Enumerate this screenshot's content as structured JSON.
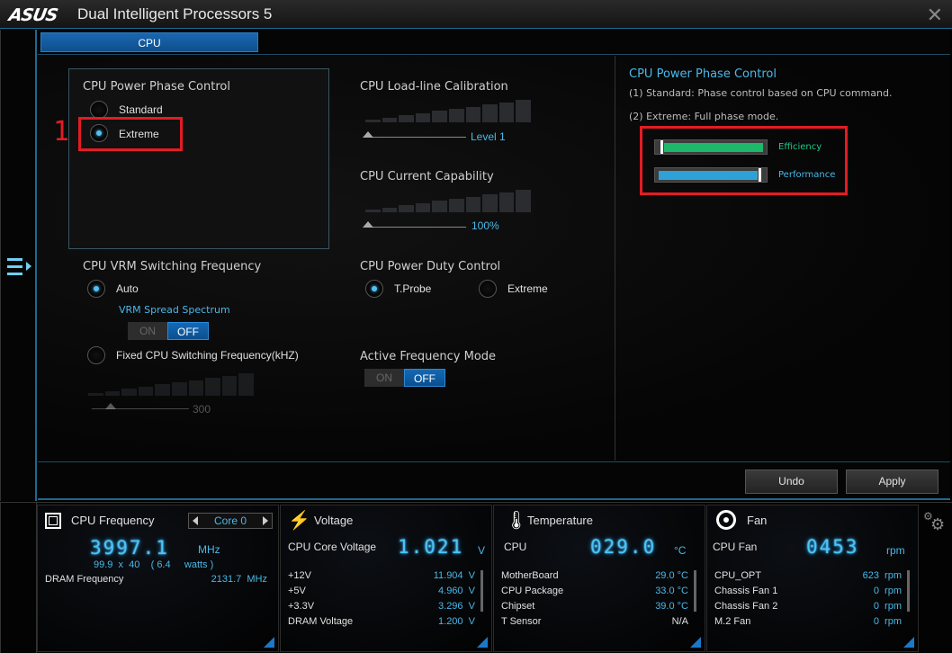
{
  "window": {
    "logo": "/ISUS",
    "title": "Dual Intelligent Processors 5",
    "close_icon": "close-icon"
  },
  "tabs": [
    {
      "label": "CPU",
      "active": true
    }
  ],
  "phase_control": {
    "title": "CPU Power Phase Control",
    "options": [
      {
        "label": "Standard",
        "selected": false
      },
      {
        "label": "Extreme",
        "selected": true
      }
    ],
    "annotation": "1"
  },
  "vrm": {
    "title": "CPU VRM Switching Frequency",
    "auto_label": "Auto",
    "auto_selected": true,
    "spread_title": "VRM Spread Spectrum",
    "spread_toggle": {
      "on": "ON",
      "off": "OFF",
      "value": "OFF"
    },
    "fixed_label": "Fixed CPU Switching Frequency(kHZ)",
    "fixed_selected": false,
    "fixed_value": "300"
  },
  "llc": {
    "title": "CPU Load-line Calibration",
    "value": "Level 1"
  },
  "current": {
    "title": "CPU Current Capability",
    "value": "100%"
  },
  "duty": {
    "title": "CPU Power Duty Control",
    "options": [
      {
        "label": "T.Probe",
        "selected": true
      },
      {
        "label": "Extreme",
        "selected": false
      }
    ]
  },
  "afm": {
    "title": "Active Frequency Mode",
    "toggle": {
      "on": "ON",
      "off": "OFF",
      "value": "OFF"
    }
  },
  "info": {
    "title": "CPU Power Phase Control",
    "lines": [
      "(1) Standard: Phase control based on CPU command.",
      "(2) Extreme: Full phase mode."
    ],
    "meters": [
      {
        "label": "Efficiency",
        "color": "#1db86a",
        "label_color": "#1dc98a",
        "level": 0.05
      },
      {
        "label": "Performance",
        "color": "#2ea2d6",
        "label_color": "#4ab8e8",
        "level": 0.95
      }
    ]
  },
  "actions": {
    "undo": "Undo",
    "apply": "Apply"
  },
  "dock": {
    "cpu_freq": {
      "title": "CPU Frequency",
      "core": "Core 0",
      "value": "3997.1",
      "unit": "MHz",
      "detail": "99.9  x  40    ( 6.4     watts )",
      "dram_label": "DRAM Frequency",
      "dram_value": "2131.7  MHz"
    },
    "voltage": {
      "title": "Voltage",
      "main_label": "CPU Core Voltage",
      "value": "1.021",
      "unit": "V",
      "rows": [
        {
          "label": "+12V",
          "value": "11.904  V"
        },
        {
          "label": "+5V",
          "value": "4.960  V"
        },
        {
          "label": "+3.3V",
          "value": "3.296  V"
        },
        {
          "label": "DRAM Voltage",
          "value": "1.200  V"
        }
      ]
    },
    "temperature": {
      "title": "Temperature",
      "main_label": "CPU",
      "value": "029.0",
      "unit": "°C",
      "rows": [
        {
          "label": "MotherBoard",
          "value": "29.0 °C"
        },
        {
          "label": "CPU Package",
          "value": "33.0 °C"
        },
        {
          "label": "Chipset",
          "value": "39.0 °C"
        },
        {
          "label": "T Sensor",
          "value": "N/A"
        }
      ]
    },
    "fan": {
      "title": "Fan",
      "main_label": "CPU Fan",
      "value": "0453",
      "unit": "rpm",
      "rows": [
        {
          "label": "CPU_OPT",
          "value": "623  rpm"
        },
        {
          "label": "Chassis Fan 1",
          "value": "0  rpm"
        },
        {
          "label": "Chassis Fan 2",
          "value": "0  rpm"
        },
        {
          "label": "M.2 Fan",
          "value": "0  rpm"
        }
      ]
    }
  }
}
